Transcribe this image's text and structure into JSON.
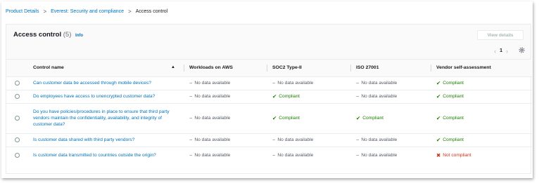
{
  "breadcrumb": {
    "items": [
      "Product Details",
      "Everest: Security and compliance",
      "Access control"
    ]
  },
  "panel": {
    "title": "Access control",
    "count": "(5)",
    "info_label": "Info",
    "view_details_label": "View details"
  },
  "pager": {
    "prev_icon": "chevron-left-icon",
    "page": "1",
    "next_icon": "chevron-right-icon",
    "settings_icon": "gear-icon"
  },
  "table": {
    "headers": [
      "Control name",
      "Workloads on AWS",
      "SOC2 Type-II",
      "ISO 27001",
      "Vendor self-assessment"
    ],
    "sort_indicator": "▲",
    "rows": [
      {
        "question": "Can customer data be accessed through mobile devices?",
        "workloads": "No data available",
        "soc2": "No data available",
        "iso": "No data available",
        "vendor": "Compliant"
      },
      {
        "question": "Do employees have access to unencrypted customer data?",
        "workloads": "No data available",
        "soc2": "Compliant",
        "iso": "No data available",
        "vendor": "Compliant"
      },
      {
        "question": "Do you have policies/procedures in place to ensure that third party vendors maintain the confidentiality, availability, and integrity of customer data?",
        "workloads": "No data available",
        "soc2": "Compliant",
        "iso": "Compliant",
        "vendor": "Compliant"
      },
      {
        "question": "Is customer data shared with third party vendors?",
        "workloads": "No data available",
        "soc2": "No data available",
        "iso": "No data available",
        "vendor": "Compliant"
      },
      {
        "question": "Is customer data transmitted to countries outside the origin?",
        "workloads": "No data available",
        "soc2": "No data available",
        "iso": "No data available",
        "vendor": "Not compliant"
      }
    ]
  },
  "colors": {
    "link": "#0073bb",
    "compliant": "#1d8102",
    "not_compliant": "#d13212",
    "no_data": "#545b64"
  }
}
